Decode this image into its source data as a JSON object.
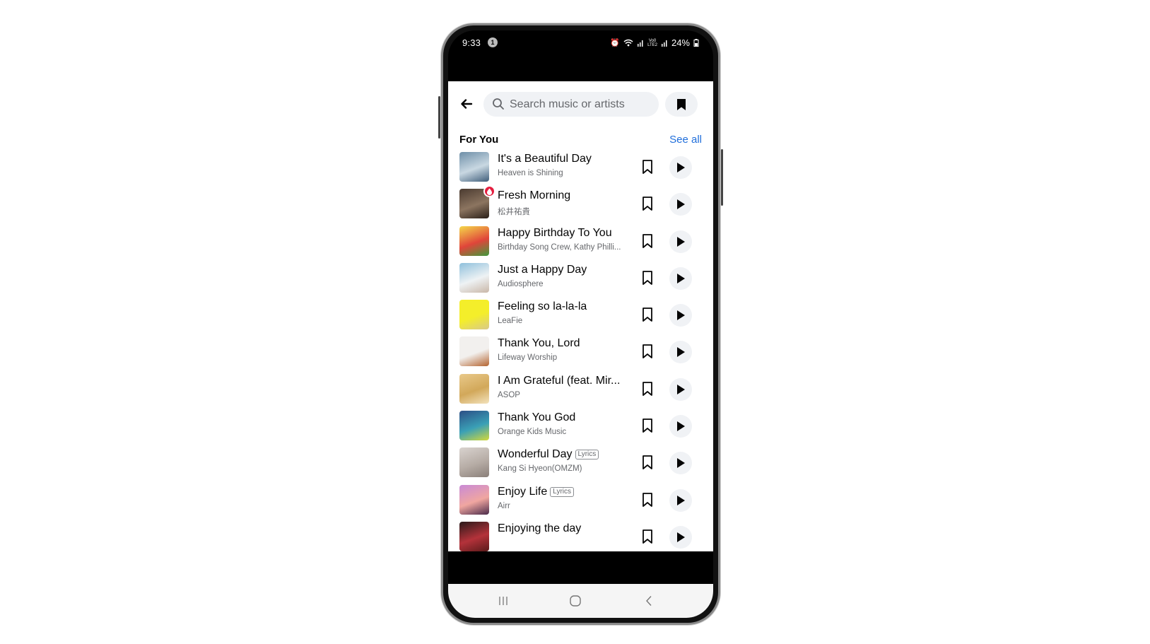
{
  "status_bar": {
    "time": "9:33",
    "notification_count": "1",
    "battery": "24%",
    "icons": [
      "alarm-icon",
      "wifi-icon",
      "signal-icon",
      "volte-lte2-icon",
      "signal-icon",
      "battery-charging-icon"
    ]
  },
  "header": {
    "back_icon": "arrow-left-icon",
    "search_placeholder": "Search music or artists",
    "search_value": "",
    "saved_icon": "bookmark-filled-icon"
  },
  "section": {
    "title": "For You",
    "see_all_label": "See all"
  },
  "songs": [
    {
      "title": "It's a Beautiful Day",
      "artist": "Heaven is Shining",
      "lyrics": "",
      "badge": false,
      "art_colors": [
        "#6e8fa8",
        "#c9d8e2",
        "#3f5d7a"
      ]
    },
    {
      "title": "Fresh Morning",
      "artist": "松井祐貴",
      "lyrics": "",
      "badge": true,
      "art_colors": [
        "#4a3a30",
        "#8c7560",
        "#2a1f18"
      ]
    },
    {
      "title": "Happy Birthday To You",
      "artist": "Birthday Song Crew, Kathy Philli...",
      "lyrics": "",
      "badge": false,
      "art_colors": [
        "#f5d84a",
        "#e0453a",
        "#3f9b3c"
      ]
    },
    {
      "title": "Just a Happy Day",
      "artist": "Audiosphere",
      "lyrics": "",
      "badge": false,
      "art_colors": [
        "#8fc0dc",
        "#eef2f4",
        "#c9b7a8"
      ]
    },
    {
      "title": "Feeling so la-la-la",
      "artist": "LeaFie",
      "lyrics": "",
      "badge": false,
      "art_colors": [
        "#f4ee2a",
        "#f4ee2a",
        "#d9c98a"
      ]
    },
    {
      "title": "Thank You, Lord",
      "artist": "Lifeway Worship",
      "lyrics": "",
      "badge": false,
      "art_colors": [
        "#f2f0ee",
        "#f2f0ee",
        "#b4632f"
      ]
    },
    {
      "title": "I Am Grateful (feat. Mir...",
      "artist": "ASOP",
      "lyrics": "",
      "badge": false,
      "art_colors": [
        "#e9c98a",
        "#d2a85a",
        "#f3e3bd"
      ]
    },
    {
      "title": "Thank You God",
      "artist": "Orange Kids Music",
      "lyrics": "",
      "badge": false,
      "art_colors": [
        "#2c4f86",
        "#3aa0b6",
        "#d4d93a"
      ]
    },
    {
      "title": "Wonderful Day",
      "artist": "Kang Si Hyeon(OMZM)",
      "lyrics": "Lyrics",
      "badge": false,
      "art_colors": [
        "#d9d3cf",
        "#b6aca5",
        "#8a7f79"
      ]
    },
    {
      "title": "Enjoy Life",
      "artist": "Airr",
      "lyrics": "Lyrics",
      "badge": false,
      "art_colors": [
        "#c98ad6",
        "#f0a6a0",
        "#4a2a4a"
      ]
    },
    {
      "title": "Enjoying the day",
      "artist": "",
      "lyrics": "",
      "badge": false,
      "art_colors": [
        "#2a1a1a",
        "#b4323a",
        "#5a1a1a"
      ]
    }
  ],
  "nav_bar": {
    "recents_icon": "recent-apps-icon",
    "home_icon": "home-icon",
    "back_icon": "back-icon"
  }
}
